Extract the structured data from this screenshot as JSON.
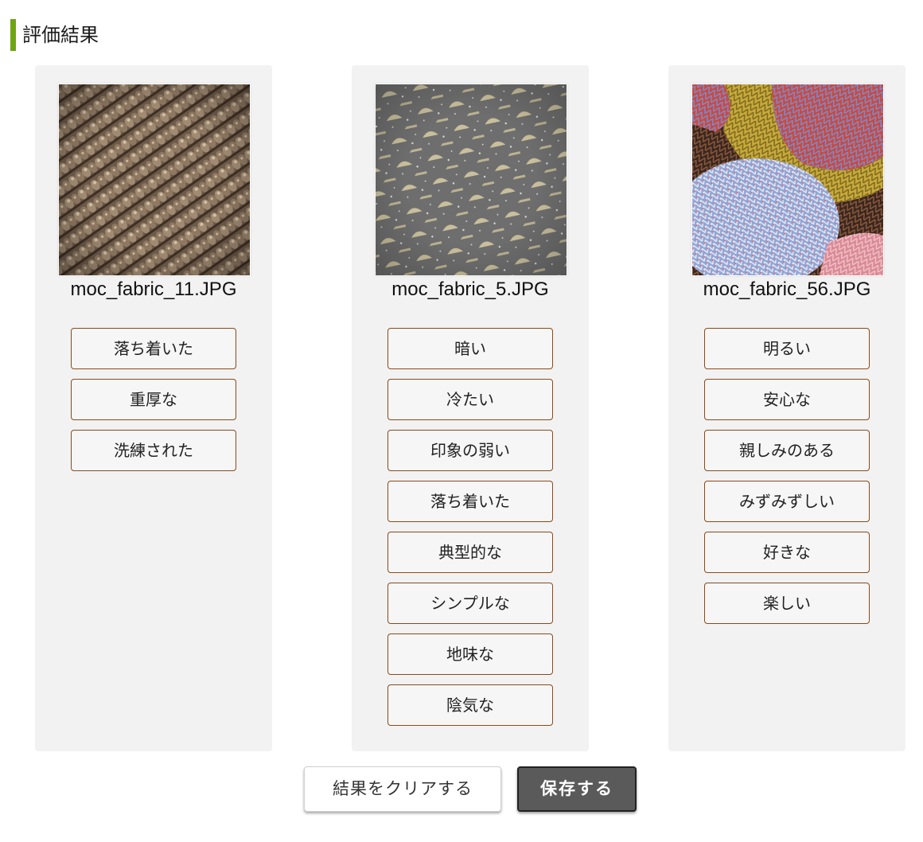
{
  "page": {
    "title": "評価結果",
    "accent_color": "#6ea511"
  },
  "cards": [
    {
      "filename": "moc_fabric_11.JPG",
      "image_description_icon": "fabric-brown-ribbed-image",
      "tags": [
        "落ち着いた",
        "重厚な",
        "洗練された"
      ]
    },
    {
      "filename": "moc_fabric_5.JPG",
      "image_description_icon": "fabric-gray-sparkle-image",
      "tags": [
        "暗い",
        "冷たい",
        "印象の弱い",
        "落ち着いた",
        "典型的な",
        "シンプルな",
        "地味な",
        "陰気な"
      ]
    },
    {
      "filename": "moc_fabric_56.JPG",
      "image_description_icon": "fabric-colorful-knit-image",
      "tags": [
        "明るい",
        "安心な",
        "親しみのある",
        "みずみずしい",
        "好きな",
        "楽しい"
      ]
    }
  ],
  "actions": {
    "clear_label": "結果をクリアする",
    "save_label": "保存する"
  }
}
